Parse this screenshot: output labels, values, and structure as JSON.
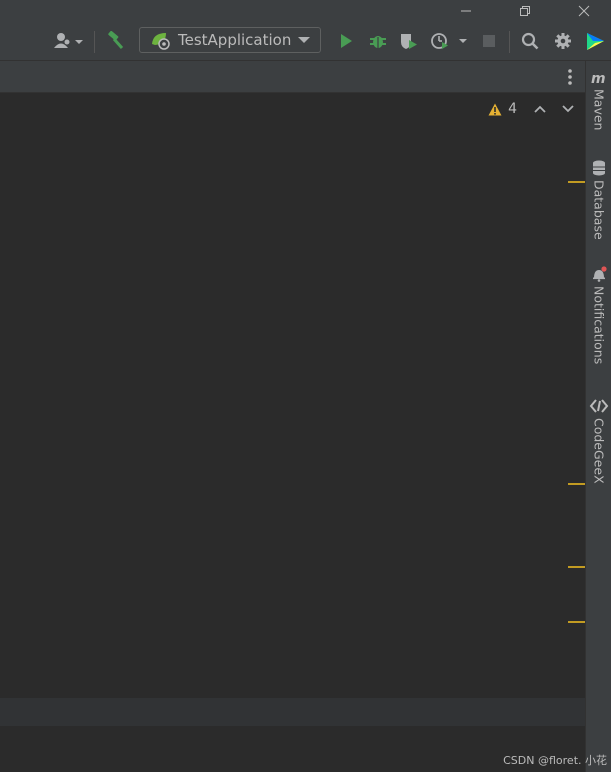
{
  "toolbar": {
    "run_configuration": "TestApplication"
  },
  "inspection": {
    "warning_count": "4"
  },
  "tool_windows": [
    {
      "label": "Maven",
      "icon": "maven-icon"
    },
    {
      "label": "Database",
      "icon": "database-icon"
    },
    {
      "label": "Notifications",
      "icon": "bell-icon"
    },
    {
      "label": "CodeGeeX",
      "icon": "codegeex-icon"
    }
  ],
  "watermark": "CSDN @floret. 小花",
  "colors": {
    "background": "#2b2b2b",
    "panel": "#3c3f41",
    "run_green": "#499c54",
    "warning_marker": "#c29b22"
  }
}
